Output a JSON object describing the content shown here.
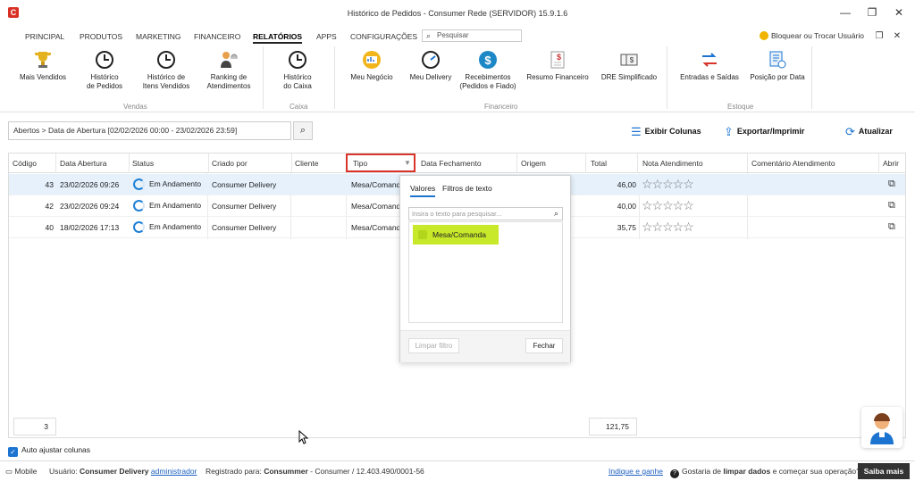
{
  "window": {
    "title": "Histórico de Pedidos - Consumer Rede (SERVIDOR) 15.9.1.6",
    "minimize": "—",
    "restore": "❐",
    "close": "✕",
    "logo": "C"
  },
  "menu": {
    "items": [
      "PRINCIPAL",
      "PRODUTOS",
      "MARKETING",
      "FINANCEIRO",
      "RELATÓRIOS",
      "APPS",
      "CONFIGURAÇÕES"
    ],
    "active": "RELATÓRIOS",
    "search_placeholder": "Pesquisar",
    "lock_label": "Bloquear ou Trocar Usuário"
  },
  "ribbon": {
    "vendas": {
      "label": "Vendas",
      "buttons": [
        "Mais Vendidos",
        "Histórico\nde Pedidos",
        "Histórico de\nItens Vendidos",
        "Ranking de\nAtendimentos"
      ]
    },
    "caixa": {
      "label": "Caixa",
      "buttons": [
        "Histórico\ndo Caixa"
      ]
    },
    "financeiro": {
      "label": "Financeiro",
      "buttons": [
        "Meu Negócio",
        "Meu Delivery",
        "Recebimentos\n(Pedidos e Fiado)",
        "Resumo Financeiro",
        "DRE Simplificado"
      ]
    },
    "estoque": {
      "label": "Estoque",
      "buttons": [
        "Entradas e Saídas",
        "Posição por Data"
      ]
    }
  },
  "toolbar": {
    "breadcrumb": "Abertos > Data de Abertura [02/02/2026 00:00 - 23/02/2026 23:59]",
    "exibir_colunas": "Exibir Colunas",
    "exportar": "Exportar/Imprimir",
    "atualizar": "Atualizar"
  },
  "grid": {
    "columns": [
      "Código",
      "Data Abertura",
      "Status",
      "Criado por",
      "Cliente",
      "Tipo",
      "Data Fechamento",
      "Origem",
      "Total",
      "Nota Atendimento",
      "Comentário Atendimento",
      "Abrir"
    ],
    "rows": [
      {
        "codigo": "43",
        "data": "23/02/2026 09:26",
        "status": "Em Andamento",
        "criado": "Consumer Delivery",
        "cliente": "",
        "tipo": "Mesa/Comanda",
        "total": "46,00",
        "stars": "☆☆☆☆☆"
      },
      {
        "codigo": "42",
        "data": "23/02/2026 09:24",
        "status": "Em Andamento",
        "criado": "Consumer Delivery",
        "cliente": "",
        "tipo": "Mesa/Comanda",
        "total": "40,00",
        "stars": "☆☆☆☆☆"
      },
      {
        "codigo": "40",
        "data": "18/02/2026 17:13",
        "status": "Em Andamento",
        "criado": "Consumer Delivery",
        "cliente": "",
        "tipo": "Mesa/Comanda",
        "total": "35,75",
        "stars": "☆☆☆☆☆"
      }
    ],
    "footer_count": "3",
    "footer_total": "121,75"
  },
  "filter_popup": {
    "tab_values": "Valores",
    "tab_text": "Filtros de texto",
    "search_placeholder": "Insira o texto para pesquisar...",
    "items": [
      "Mesa/Comanda"
    ],
    "clear": "Limpar filtro",
    "close": "Fechar"
  },
  "bottom": {
    "auto_adjust": "Auto ajustar colunas",
    "mobile": "Mobile",
    "user_prefix": "Usuário:",
    "user_name": "Consumer Delivery",
    "user_role": "administrador",
    "registered_prefix": "Registrado para:",
    "registered_name": "Consummer",
    "registered_rest": "- Consumer / 12.403.490/0001-56",
    "indique": "Indique e ganhe",
    "promo_pre": "Gostaria de",
    "promo_bold": "limpar dados",
    "promo_post": "e começar sua operação?",
    "saiba": "Saiba mais"
  },
  "colors": {
    "accent": "#1b74d0",
    "highlight": "#c8e82a",
    "tipo_border": "#d9342b"
  }
}
